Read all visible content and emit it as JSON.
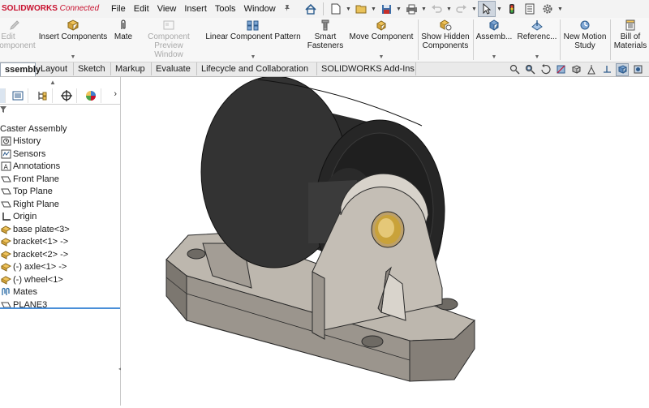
{
  "titlebar": {
    "brand": "SOLIDWORKS",
    "brand_suffix": "Connected",
    "menu": [
      "File",
      "Edit",
      "View",
      "Insert",
      "Tools",
      "Window"
    ]
  },
  "commands": {
    "edit_component": "Edit Component",
    "insert_components": "Insert Components",
    "mate": "Mate",
    "component_preview": "Component Preview Window",
    "linear_pattern": "Linear Component Pattern",
    "smart_fasteners": "Smart Fasteners",
    "move_component": "Move Component",
    "show_hidden": "Show Hidden Components",
    "assembly_features": "Assemb...",
    "reference_geometry": "Referenc...",
    "new_motion_study": "New Motion Study",
    "bill_of_materials": "Bill of Materials"
  },
  "tabs": [
    "ssembly",
    "Layout",
    "Sketch",
    "Markup",
    "Evaluate",
    "Lifecycle and Collaboration",
    "SOLIDWORKS Add-Ins"
  ],
  "tree": {
    "root": "Caster Assembly",
    "items": [
      "History",
      "Sensors",
      "Annotations",
      "Front Plane",
      "Top Plane",
      "Right Plane",
      "Origin",
      "base plate<3>",
      "bracket<1> ->",
      "bracket<2> ->",
      "(-) axle<1> ->",
      "(-) wheel<1>",
      "Mates",
      "PLANE3"
    ]
  },
  "colors": {
    "brand_red": "#c8102e",
    "wheel": "#2b2b2b",
    "bracket": "#bdb7ae",
    "bushing": "#c9a23a"
  }
}
